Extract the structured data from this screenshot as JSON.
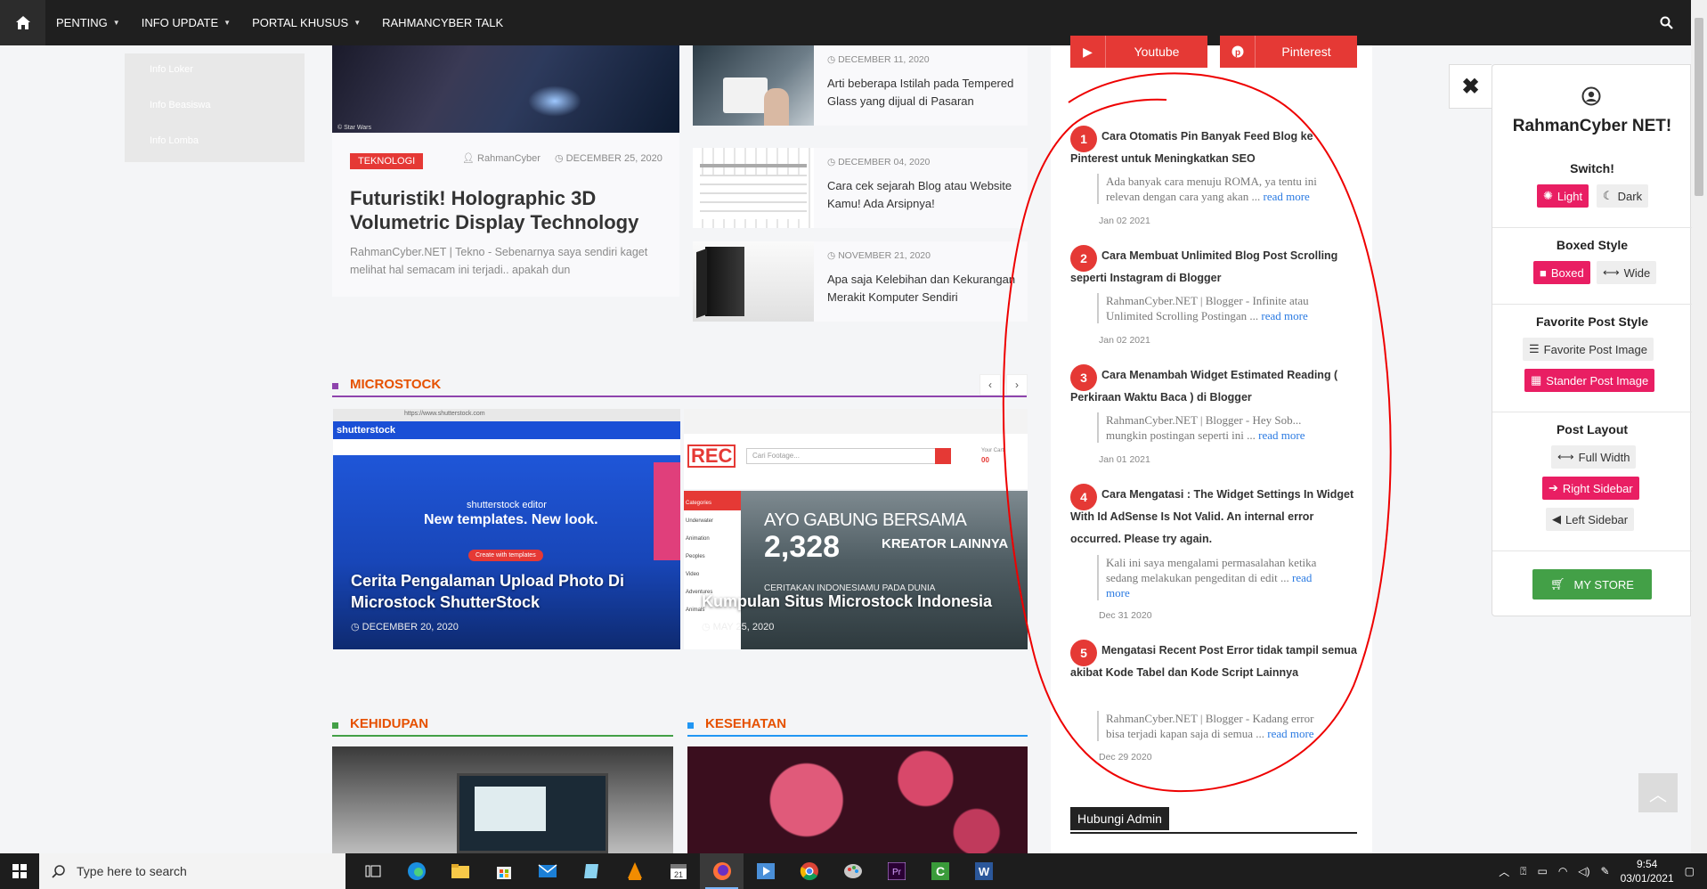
{
  "nav": {
    "items": [
      {
        "label": "PENTING",
        "has_caret": true
      },
      {
        "label": "INFO UPDATE",
        "has_caret": true
      },
      {
        "label": "PORTAL KHUSUS",
        "has_caret": true
      },
      {
        "label": "RAHMANCYBER TALK",
        "has_caret": false
      }
    ]
  },
  "submenu": [
    "Info Loker",
    "Info Beasiswa",
    "Info Lomba"
  ],
  "featured": {
    "image_caption": "© Star Wars",
    "category": "TEKNOLOGI",
    "author": "RahmanCyber",
    "date": "DECEMBER 25, 2020",
    "title": "Futuristik! Holographic 3D Volumetric Display Technology",
    "excerpt": "RahmanCyber.NET | Tekno - Sebenarnya saya sendiri kaget melihat hal semacam ini terjadi.. apakah dun"
  },
  "small_posts": [
    {
      "date": "DECEMBER 11, 2020",
      "title": "Arti beberapa Istilah pada Tempered Glass yang dijual di Pasaran"
    },
    {
      "date": "DECEMBER 04, 2020",
      "title": "Cara cek sejarah Blog atau Website Kamu! Ada Arsipnya!"
    },
    {
      "date": "NOVEMBER 21, 2020",
      "title": "Apa saja Kelebihan dan Kekurangan Merakit Komputer Sendiri"
    }
  ],
  "sections": {
    "microstock": "MICROSTOCK",
    "kehidupan": "KEHIDUPAN",
    "kesehatan": "KESEHATAN"
  },
  "microstock_posts": [
    {
      "title": "Cerita Pengalaman Upload Photo Di Microstock ShutterStock",
      "date": "DECEMBER 20, 2020",
      "img_brand": "shutterstock",
      "img_banner_small": "shutterstock editor",
      "img_banner_big": "New templates. New look.",
      "img_button": "Create with templates",
      "img_url": "https://www.shutterstock.com"
    },
    {
      "title": "Kumpulan Situs Microstock Indonesia",
      "date": "MAY 25, 2020",
      "img_line1": "AYO GABUNG BERSAMA",
      "img_number": "2,328",
      "img_line2": "KREATOR LAINNYA",
      "img_line3": "CERITAKAN INDONESIAMU PADA DUNIA",
      "img_logo": "REC",
      "img_search": "Cari Footage...",
      "img_cart": "Your Cart",
      "img_cart_count": "00",
      "img_menu": [
        "Categories",
        "Underwater",
        "Animation",
        "Peoples",
        "Video",
        "Adventures",
        "Animals"
      ]
    }
  ],
  "sidebar": {
    "social": [
      {
        "label": "Youtube",
        "icon": "youtube-icon"
      },
      {
        "label": "Pinterest",
        "icon": "pinterest-icon"
      }
    ],
    "popular": [
      {
        "num": "1",
        "title": "Cara Otomatis Pin Banyak Feed Blog ke Pinterest untuk Meningkatkan SEO",
        "excerpt": "Ada banyak cara menuju ROMA, ya tentu ini relevan dengan cara yang akan ...",
        "more": "read more",
        "date": "Jan 02 2021"
      },
      {
        "num": "2",
        "title": "Cara Membuat Unlimited Blog Post Scrolling seperti Instagram di Blogger",
        "excerpt": "RahmanCyber.NET | Blogger - Infinite atau Unlimited Scrolling Postingan ...",
        "more": "read more",
        "date": "Jan 02 2021"
      },
      {
        "num": "3",
        "title": "Cara Menambah Widget Estimated Reading ( Perkiraan Waktu Baca ) di Blogger",
        "excerpt": "RahmanCyber.NET | Blogger - Hey Sob... mungkin postingan seperti ini ...",
        "more": "read more",
        "date": "Jan 01 2021"
      },
      {
        "num": "4",
        "title": "Cara Mengatasi : The Widget Settings In Widget With Id AdSense Is Not Valid. An internal error occurred. Please try again.",
        "excerpt": "Kali ini saya mengalami permasalahan ketika sedang melakukan pengeditan di edit ...",
        "more": "read more",
        "date": "Dec 31 2020"
      },
      {
        "num": "5",
        "title": "Mengatasi Recent Post Error tidak tampil semua akibat Kode Tabel dan Kode Script Lainnya",
        "excerpt": "RahmanCyber.NET | Blogger - Kadang error bisa terjadi kapan saja di semua ...",
        "more": "read more",
        "date": "Dec 29 2020"
      }
    ],
    "hubungi": "Hubungi Admin"
  },
  "panel": {
    "title": "RahmanCyber NET!",
    "switch": {
      "title": "Switch!",
      "light": "Light",
      "dark": "Dark"
    },
    "boxed": {
      "title": "Boxed Style",
      "boxed": "Boxed",
      "wide": "Wide"
    },
    "fav": {
      "title": "Favorite Post Style",
      "image": "Favorite Post Image",
      "stander": "Stander Post Image"
    },
    "layout": {
      "title": "Post Layout",
      "full": "Full Width",
      "right": "Right Sidebar",
      "left": "Left Sidebar"
    },
    "store": "MY STORE"
  },
  "taskbar": {
    "search_placeholder": "Type here to search",
    "time": "9:54",
    "date": "03/01/2021",
    "calendar_day": "21"
  },
  "colors": {
    "accent_red": "#e53935",
    "pink": "#e91e63",
    "green": "#43a047",
    "microstock_line": "#8e44ad",
    "kehidupan_line": "#43a047",
    "kesehatan_line": "#2196f3"
  }
}
